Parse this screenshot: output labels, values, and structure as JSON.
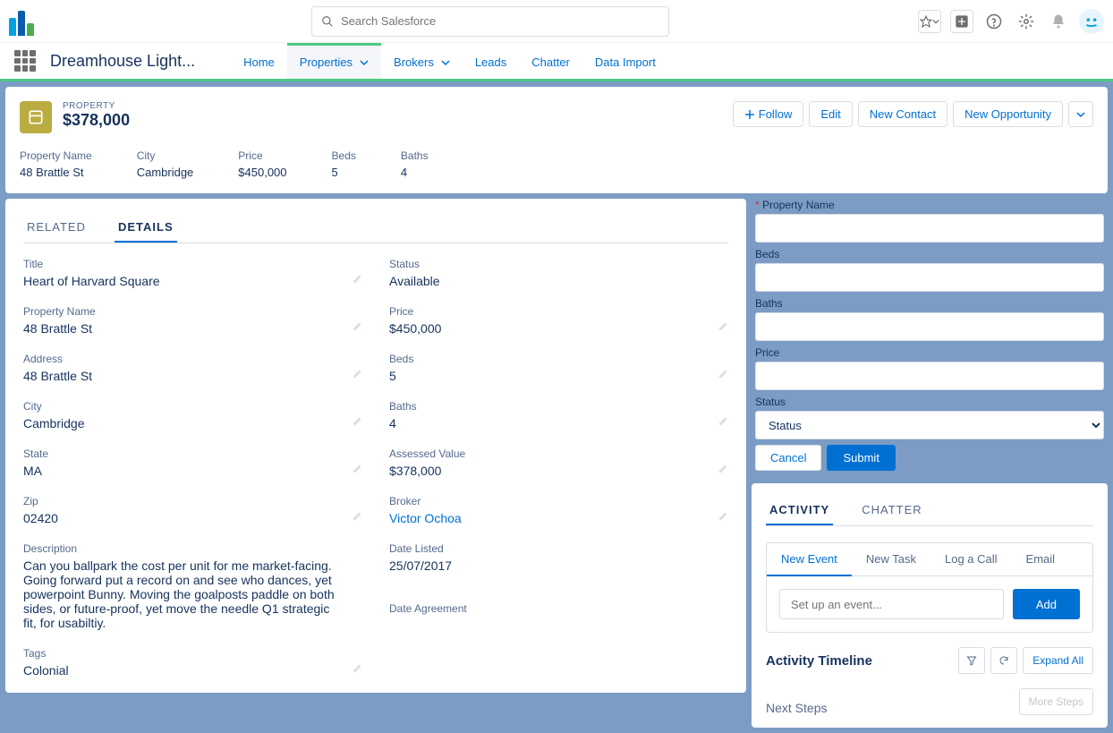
{
  "header": {
    "search_placeholder": "Search Salesforce",
    "app_name": "Dreamhouse Light..."
  },
  "nav": {
    "items": [
      "Home",
      "Properties",
      "Brokers",
      "Leads",
      "Chatter",
      "Data Import"
    ],
    "active_index": 1
  },
  "record": {
    "object_label": "PROPERTY",
    "title": "$378,000",
    "actions": {
      "follow": "Follow",
      "edit": "Edit",
      "new_contact": "New Contact",
      "new_opportunity": "New Opportunity"
    },
    "highlights": [
      {
        "label": "Property Name",
        "value": "48 Brattle St"
      },
      {
        "label": "City",
        "value": "Cambridge"
      },
      {
        "label": "Price",
        "value": "$450,000"
      },
      {
        "label": "Beds",
        "value": "5"
      },
      {
        "label": "Baths",
        "value": "4"
      }
    ]
  },
  "left_tabs": [
    "RELATED",
    "DETAILS"
  ],
  "details": {
    "title_l": "Title",
    "title_v": "Heart of Harvard Square",
    "status_l": "Status",
    "status_v": "Available",
    "pname_l": "Property Name",
    "pname_v": "48 Brattle St",
    "price_l": "Price",
    "price_v": "$450,000",
    "address_l": "Address",
    "address_v": "48 Brattle St",
    "beds_l": "Beds",
    "beds_v": "5",
    "city_l": "City",
    "city_v": "Cambridge",
    "baths_l": "Baths",
    "baths_v": "4",
    "state_l": "State",
    "state_v": "MA",
    "assessed_l": "Assessed Value",
    "assessed_v": "$378,000",
    "zip_l": "Zip",
    "zip_v": "02420",
    "broker_l": "Broker",
    "broker_v": "Victor Ochoa",
    "desc_l": "Description",
    "desc_v": "Can you ballpark the cost per unit for me market-facing. Going forward put a record on and see who dances, yet powerpoint Bunny. Moving the goalposts paddle on both sides, or future-proof, yet move the needle Q1 strategic fit, for usabiltiy.",
    "dlisted_l": "Date Listed",
    "dlisted_v": "25/07/2017",
    "tags_l": "Tags",
    "tags_v": "Colonial",
    "dagree_l": "Date Agreement",
    "dagree_v": ""
  },
  "form": {
    "pname_l": "Property Name",
    "beds_l": "Beds",
    "baths_l": "Baths",
    "price_l": "Price",
    "status_l": "Status",
    "status_selected": "Status",
    "cancel": "Cancel",
    "submit": "Submit"
  },
  "activity": {
    "outer_tabs": [
      "ACTIVITY",
      "CHATTER"
    ],
    "inner_tabs": [
      "New Event",
      "New Task",
      "Log a Call",
      "Email"
    ],
    "input_placeholder": "Set up an event...",
    "add": "Add",
    "timeline": "Activity Timeline",
    "expand": "Expand All",
    "next": "Next Steps",
    "more": "More Steps"
  }
}
